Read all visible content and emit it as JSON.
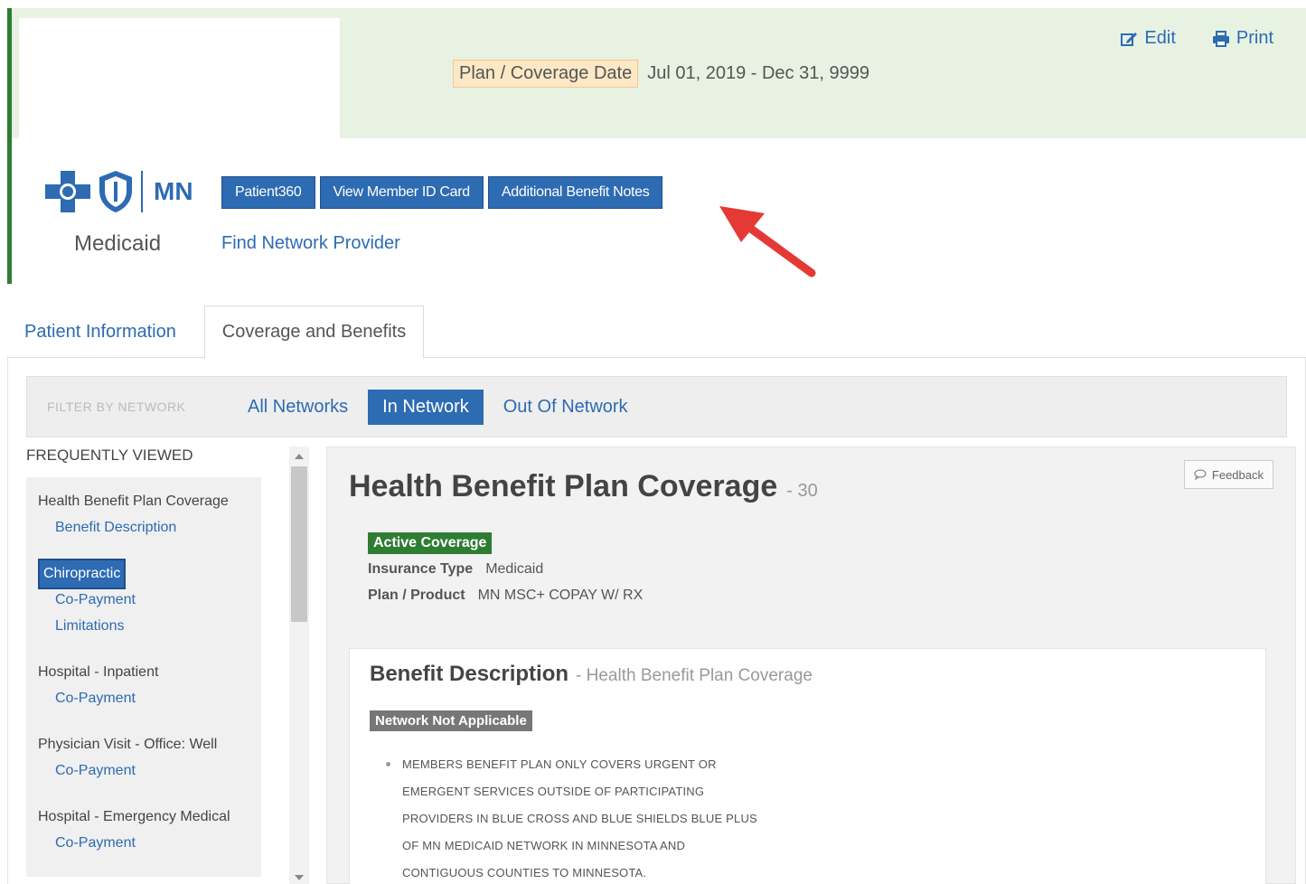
{
  "header": {
    "coverage_label": "Plan / Coverage Date",
    "coverage_value": "Jul 01, 2019 - Dec 31, 9999",
    "edit_label": "Edit",
    "print_label": "Print",
    "logo_mn": "MN",
    "logo_sub": "Medicaid",
    "buttons": [
      "Patient360",
      "View Member ID Card",
      "Additional Benefit Notes"
    ],
    "find_provider": "Find Network Provider"
  },
  "tabs": [
    "Patient Information",
    "Coverage and Benefits"
  ],
  "filter": {
    "label": "FILTER BY NETWORK",
    "options": [
      "All Networks",
      "In Network",
      "Out Of Network"
    ],
    "selected": "In Network"
  },
  "sidebar": {
    "title": "FREQUENTLY VIEWED",
    "groups": [
      {
        "title": "Health Benefit Plan Coverage",
        "items": [
          "Benefit Description"
        ]
      },
      {
        "title": "Chiropractic",
        "items": [
          "Co-Payment",
          "Limitations"
        ]
      },
      {
        "title": "Hospital - Inpatient",
        "items": [
          "Co-Payment"
        ]
      },
      {
        "title": "Physician Visit - Office: Well",
        "items": [
          "Co-Payment"
        ]
      },
      {
        "title": "Hospital - Emergency Medical",
        "items": [
          "Co-Payment"
        ]
      }
    ]
  },
  "main": {
    "title": "Health Benefit Plan Coverage",
    "code": "- 30",
    "feedback_label": "Feedback",
    "status_badge": "Active Coverage",
    "insurance_type_label": "Insurance Type",
    "insurance_type_value": "Medicaid",
    "plan_product_label": "Plan / Product",
    "plan_product_value": "MN MSC+ COPAY W/ RX",
    "benefit": {
      "title": "Benefit Description",
      "subtitle": "- Health Benefit Plan Coverage",
      "network_badge": "Network Not Applicable",
      "note_lines": [
        "MEMBERS BENEFIT PLAN ONLY COVERS URGENT OR",
        "EMERGENT SERVICES OUTSIDE OF PARTICIPATING",
        "PROVIDERS IN BLUE CROSS AND BLUE SHIELDS BLUE PLUS",
        "OF MN MEDICAID NETWORK IN MINNESOTA AND",
        "CONTIGUOUS COUNTIES TO MINNESOTA."
      ]
    }
  },
  "colors": {
    "accent": "#2d6bb3",
    "green_band": "#e7f2e3",
    "active_badge": "#2e7d32",
    "annotation_arrow": "#e53935"
  }
}
